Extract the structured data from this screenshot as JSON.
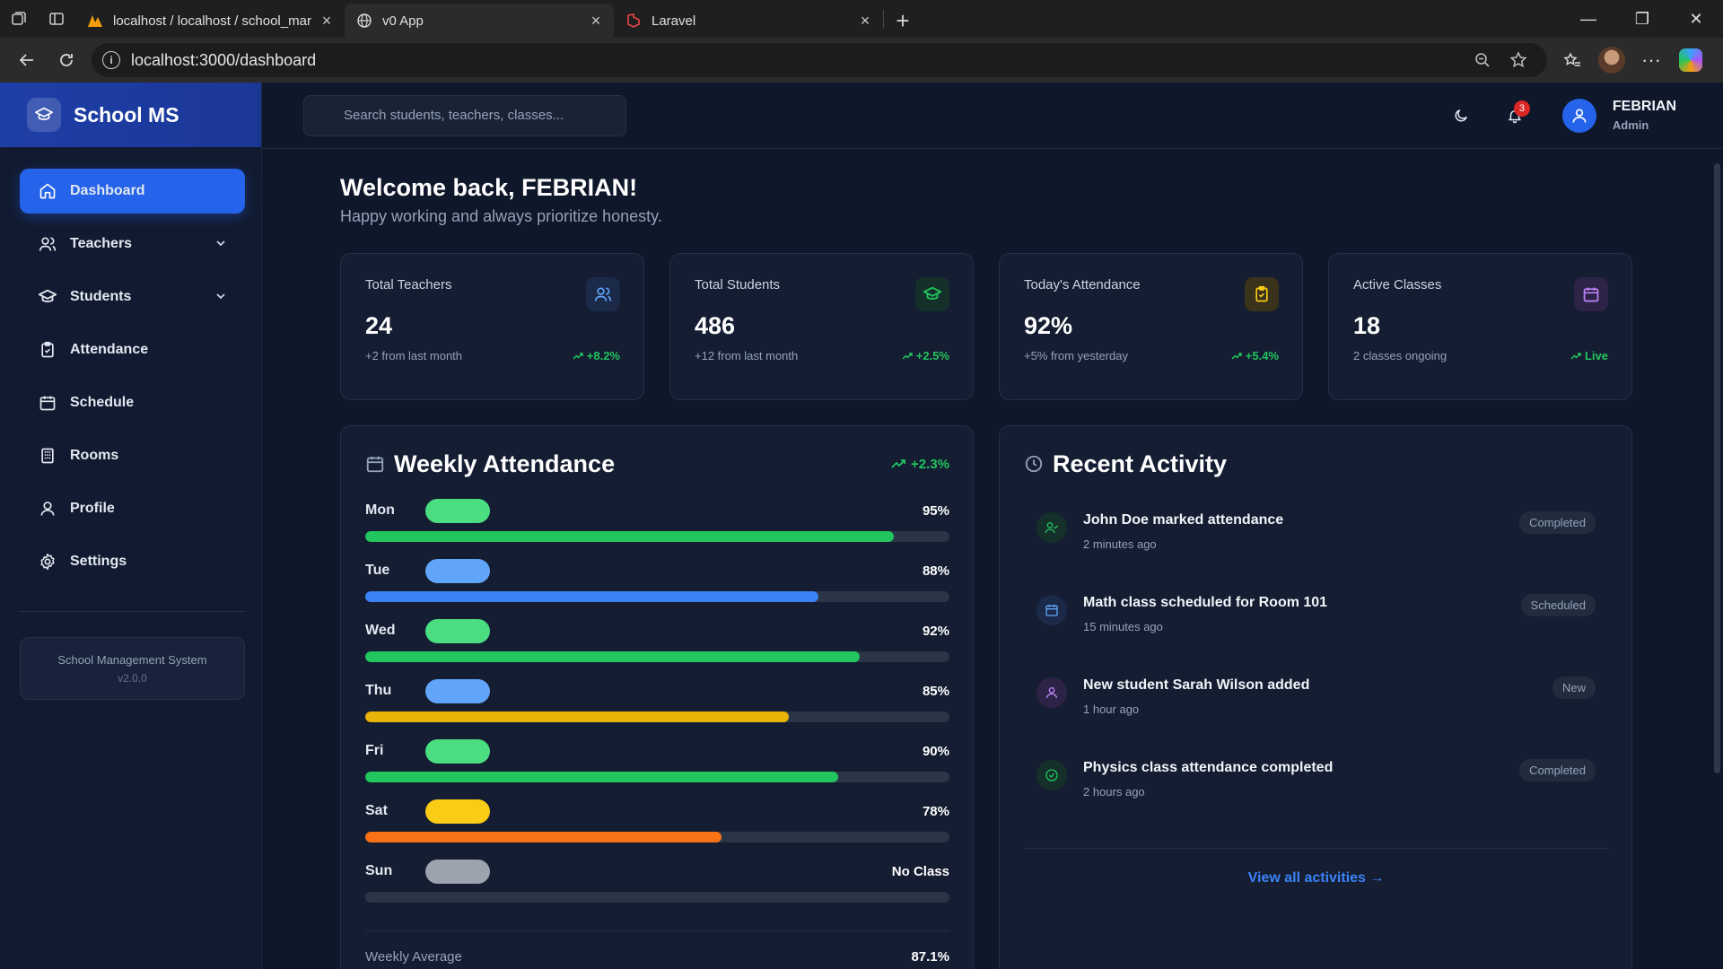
{
  "browser": {
    "tabs": [
      {
        "title": "localhost / localhost / school_mar",
        "favicon": "phpmyadmin-icon",
        "active": false
      },
      {
        "title": "v0 App",
        "favicon": "globe-icon",
        "active": true
      },
      {
        "title": "Laravel",
        "favicon": "laravel-icon",
        "active": false
      }
    ],
    "url": "localhost:3000/dashboard"
  },
  "sidebar": {
    "brand": "School MS",
    "items": [
      {
        "label": "Dashboard",
        "icon": "home-icon",
        "active": true
      },
      {
        "label": "Teachers",
        "icon": "users-icon",
        "expandable": true
      },
      {
        "label": "Students",
        "icon": "graduation-cap-icon",
        "expandable": true
      },
      {
        "label": "Attendance",
        "icon": "clipboard-check-icon"
      },
      {
        "label": "Schedule",
        "icon": "calendar-icon"
      },
      {
        "label": "Rooms",
        "icon": "building-icon"
      },
      {
        "label": "Profile",
        "icon": "user-icon"
      },
      {
        "label": "Settings",
        "icon": "gear-icon"
      }
    ],
    "footer": {
      "name": "School Management System",
      "version": "v2.0.0"
    }
  },
  "header": {
    "search_placeholder": "Search students, teachers, classes...",
    "notification_count": "3",
    "user_name": "FEBRIAN",
    "user_role": "Admin"
  },
  "welcome": {
    "title": "Welcome back, FEBRIAN!",
    "subtitle": "Happy working and always prioritize honesty."
  },
  "stats": [
    {
      "label": "Total Teachers",
      "value": "24",
      "sub": "+2 from last month",
      "trend": "+8.2%",
      "icon": "users-icon",
      "icon_color": "#60a5fa",
      "icon_bg": "#1c2a4a"
    },
    {
      "label": "Total Students",
      "value": "486",
      "sub": "+12 from last month",
      "trend": "+2.5%",
      "icon": "graduation-cap-icon",
      "icon_color": "#22c55e",
      "icon_bg": "#15302a"
    },
    {
      "label": "Today's Attendance",
      "value": "92%",
      "sub": "+5% from yesterday",
      "trend": "+5.4%",
      "icon": "clipboard-check-icon",
      "icon_color": "#facc15",
      "icon_bg": "#3a321a"
    },
    {
      "label": "Active Classes",
      "value": "18",
      "sub": "2 classes ongoing",
      "trend": "Live",
      "icon": "calendar-icon",
      "icon_color": "#c084fc",
      "icon_bg": "#2d2346"
    }
  ],
  "attendance": {
    "title": "Weekly Attendance",
    "trend": "+2.3%",
    "days": [
      {
        "day": "Mon",
        "label": "95%",
        "value": 0.905,
        "pill": "#4ade80",
        "bar": "#22c55e"
      },
      {
        "day": "Tue",
        "label": "88%",
        "value": 0.775,
        "pill": "#60a5fa",
        "bar": "#3b82f6"
      },
      {
        "day": "Wed",
        "label": "92%",
        "value": 0.847,
        "pill": "#4ade80",
        "bar": "#22c55e"
      },
      {
        "day": "Thu",
        "label": "85%",
        "value": 0.725,
        "pill": "#60a5fa",
        "bar": "#eab308"
      },
      {
        "day": "Fri",
        "label": "90%",
        "value": 0.81,
        "pill": "#4ade80",
        "bar": "#22c55e"
      },
      {
        "day": "Sat",
        "label": "78%",
        "value": 0.61,
        "pill": "#facc15",
        "bar": "#f97316"
      },
      {
        "day": "Sun",
        "label": "No Class",
        "value": 0,
        "pill": "#9ca3af",
        "bar": "#2b3548"
      }
    ],
    "average_label": "Weekly Average",
    "average_value": "87.1%"
  },
  "activity": {
    "title": "Recent Activity",
    "items": [
      {
        "title": "John Doe marked attendance",
        "time": "2 minutes ago",
        "status": "Completed",
        "icon": "user-check-icon",
        "color": "#22c55e",
        "bg": "#15302a"
      },
      {
        "title": "Math class scheduled for Room 101",
        "time": "15 minutes ago",
        "status": "Scheduled",
        "icon": "calendar-icon",
        "color": "#60a5fa",
        "bg": "#1c2a4a"
      },
      {
        "title": "New student Sarah Wilson added",
        "time": "1 hour ago",
        "status": "New",
        "icon": "user-icon",
        "color": "#c084fc",
        "bg": "#2d2346"
      },
      {
        "title": "Physics class attendance completed",
        "time": "2 hours ago",
        "status": "Completed",
        "icon": "check-circle-icon",
        "color": "#22c55e",
        "bg": "#15302a"
      }
    ],
    "view_all": "View all activities →"
  }
}
